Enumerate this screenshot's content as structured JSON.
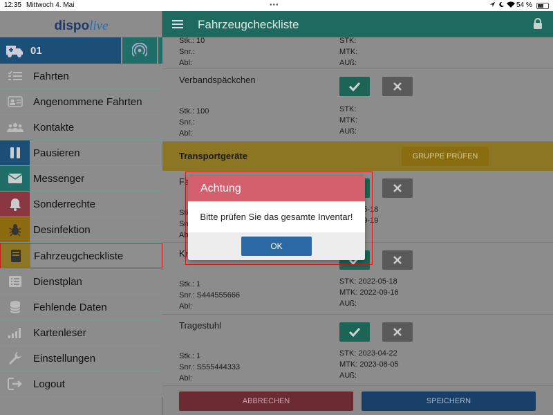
{
  "statusbar": {
    "time": "12:35",
    "date": "Mittwoch 4. Mai",
    "dots": "•••",
    "battery": "54 %"
  },
  "logo": {
    "part1": "disp",
    "part2": "o",
    "part3": "live"
  },
  "vehicle": {
    "number": "01"
  },
  "nav": [
    {
      "label": "Fahrten",
      "icon": "list-check-icon",
      "color": "#8c8c8c"
    },
    {
      "label": "Angenommene Fahrten",
      "icon": "id-card-icon",
      "color": "#8c8c8c"
    },
    {
      "label": "Kontakte",
      "icon": "users-icon",
      "color": "#8c8c8c"
    },
    {
      "label": "Pausieren",
      "icon": "pause-icon",
      "color": "#1c4f77"
    },
    {
      "label": "Messenger",
      "icon": "envelope-icon",
      "color": "#1f6f68"
    },
    {
      "label": "Sonderrechte",
      "icon": "bell-icon",
      "color": "#8a3742"
    },
    {
      "label": "Desinfektion",
      "icon": "bug-icon",
      "color": "#8c6a10"
    },
    {
      "label": "Fahrzeugcheckliste",
      "icon": "book-icon",
      "color": "#8c7624"
    },
    {
      "label": "Dienstplan",
      "icon": "list-icon",
      "color": "#8c8c8c"
    },
    {
      "label": "Fehlende Daten",
      "icon": "database-icon",
      "color": "#8c8c8c"
    },
    {
      "label": "Kartenleser",
      "icon": "signal-bars-icon",
      "color": "#8c8c8c"
    },
    {
      "label": "Einstellungen",
      "icon": "wrench-icon",
      "color": "#8c8c8c"
    },
    {
      "label": "Logout",
      "icon": "logout-icon",
      "color": "#8c8c8c"
    }
  ],
  "appbar": {
    "title": "Fahrzeugcheckliste"
  },
  "top_row": {
    "stk": "Stk.: 10",
    "snr": "Snr.:",
    "abl": "Abl:",
    "stk_r": "STK:",
    "mtk_r": "MTK:",
    "aus_r": "AUß:"
  },
  "items": [
    {
      "name": "Verbandspäckchen",
      "stk": "Stk.: 100",
      "snr": "Snr.:",
      "abl": "Abl:",
      "stk_r": "STK:",
      "mtk_r": "MTK:",
      "aus_r": "AUß:"
    },
    {
      "name": "Fa",
      "stk": "Stk",
      "snr": "Snr",
      "abl": "Abl",
      "stk_r": "2022-05-18",
      "mtk_r": "2022-09-19",
      "aus_r": ""
    },
    {
      "name": "Kr",
      "stk": "Stk.: 1",
      "snr": "Snr.: S444555666",
      "abl": "Abl:",
      "stk_r": "STK: 2022-05-18",
      "mtk_r": "MTK: 2022-09-16",
      "aus_r": "AUß:"
    },
    {
      "name": "Tragestuhl",
      "stk": "Stk.: 1",
      "snr": "Snr.: S555444333",
      "abl": "Abl:",
      "stk_r": "STK: 2023-04-22",
      "mtk_r": "MTK: 2023-08-05",
      "aus_r": "AUß:"
    }
  ],
  "group": {
    "title": "Transportgeräte",
    "button": "GRUPPE PRÜFEN"
  },
  "bottom": {
    "cancel": "ABBRECHEN",
    "save": "SPEICHERN"
  },
  "dialog": {
    "title": "Achtung",
    "message": "Bitte prüfen Sie das gesamte Inventar!",
    "ok": "OK"
  }
}
